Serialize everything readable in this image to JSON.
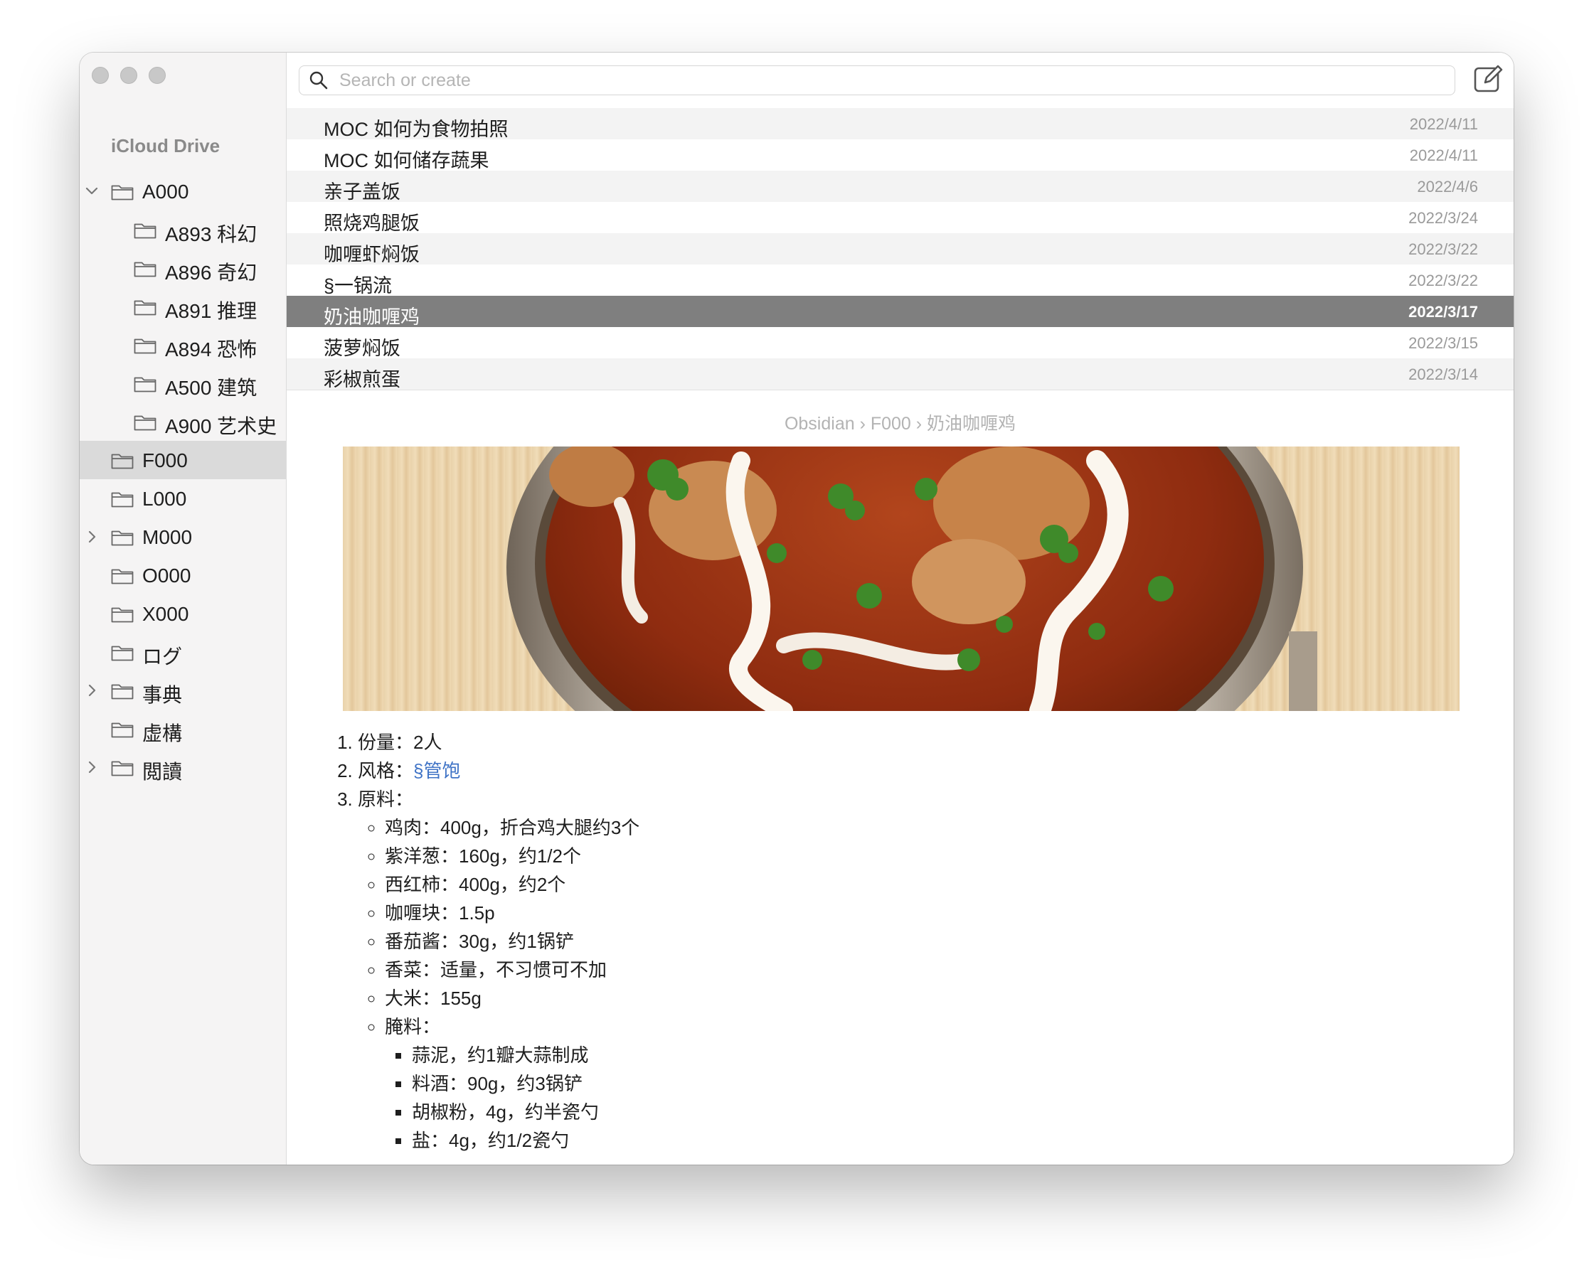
{
  "sidebar": {
    "title": "iCloud Drive",
    "items": [
      {
        "label": "A000",
        "level": 0,
        "chevron": "down"
      },
      {
        "label": "A893 科幻",
        "level": 1
      },
      {
        "label": "A896 奇幻",
        "level": 1
      },
      {
        "label": "A891 推理",
        "level": 1
      },
      {
        "label": "A894 恐怖",
        "level": 1
      },
      {
        "label": "A500 建筑",
        "level": 1
      },
      {
        "label": "A900 艺术史",
        "level": 1
      },
      {
        "label": "F000",
        "level": 0,
        "selected": true
      },
      {
        "label": "L000",
        "level": 0
      },
      {
        "label": "M000",
        "level": 0,
        "chevron": "right"
      },
      {
        "label": "O000",
        "level": 0
      },
      {
        "label": "X000",
        "level": 0
      },
      {
        "label": "ログ",
        "level": 0
      },
      {
        "label": "事典",
        "level": 0,
        "chevron": "right"
      },
      {
        "label": "虚構",
        "level": 0
      },
      {
        "label": "閲讀",
        "level": 0,
        "chevron": "right"
      }
    ]
  },
  "search": {
    "placeholder": "Search or create"
  },
  "notes": [
    {
      "title": "MOC 如何为食物拍照",
      "date": "2022/4/11"
    },
    {
      "title": "MOC 如何储存蔬果",
      "date": "2022/4/11"
    },
    {
      "title": "亲子盖饭",
      "date": "2022/4/6"
    },
    {
      "title": "照烧鸡腿饭",
      "date": "2022/3/24"
    },
    {
      "title": "咖喱虾焖饭",
      "date": "2022/3/22"
    },
    {
      "title": "§一锅流",
      "date": "2022/3/22"
    },
    {
      "title": "奶油咖喱鸡",
      "date": "2022/3/17",
      "selected": true
    },
    {
      "title": "菠萝焖饭",
      "date": "2022/3/15"
    },
    {
      "title": "彩椒煎蛋",
      "date": "2022/3/14"
    }
  ],
  "note": {
    "breadcrumb": "Obsidian › F000 › 奶油咖喱鸡",
    "list": {
      "item1": "份量：2人",
      "item2_label": "风格：",
      "item2_link": "§管饱",
      "item3": "原料：",
      "ingredients": [
        "鸡肉：400g，折合鸡大腿约3个",
        "紫洋葱：160g，约1/2个",
        "西红柿：400g，约2个",
        "咖喱块：1.5p",
        "番茄酱：30g，约1锅铲",
        "香菜：适量，不习惯可不加",
        "大米：155g"
      ],
      "marinade_label": "腌料：",
      "marinade": [
        "蒜泥，约1瓣大蒜制成",
        "料酒：90g，约3锅铲",
        "胡椒粉，4g，约半瓷勺",
        "盐：4g，约1/2瓷勺"
      ]
    }
  },
  "icons": {
    "search": "search-icon",
    "compose": "compose-icon",
    "folder": "folder-icon",
    "chevron_down": "chevron-down-icon",
    "chevron_right": "chevron-right-icon"
  }
}
